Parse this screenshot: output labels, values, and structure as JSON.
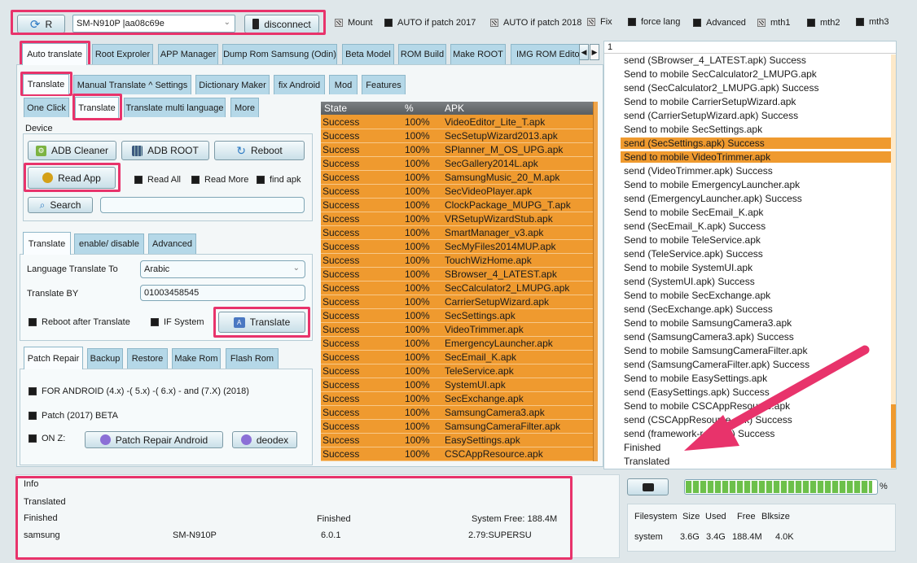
{
  "toolbar": {
    "refresh_label": "R",
    "device_select_value": "SM-N910P |aa08c69e",
    "disconnect_label": "disconnect",
    "options": [
      {
        "label": "Mount",
        "state": "indeterminate"
      },
      {
        "label": "AUTO if patch 2017",
        "state": "checked"
      },
      {
        "label": "AUTO if patch 2018",
        "state": "indeterminate"
      },
      {
        "label": "Fix",
        "state": "indeterminate"
      },
      {
        "label": "force lang",
        "state": "checked"
      },
      {
        "label": "Advanced",
        "state": "checked"
      },
      {
        "label": "mth1",
        "state": "indeterminate"
      },
      {
        "label": "mth2",
        "state": "checked"
      },
      {
        "label": "mth3",
        "state": "checked"
      }
    ]
  },
  "main_tabs": [
    "Auto translate",
    "Root Exproler",
    "APP Manager",
    "Dump Rom Samsung (Odin)",
    "Beta Model",
    "ROM Build",
    "Make ROOT",
    "IMG ROM Editor"
  ],
  "sub_tabs": [
    "Translate",
    "Manual Translate ^ Settings",
    "Dictionary Maker",
    "fix Android",
    "Mod",
    "Features"
  ],
  "sub_tabs2": [
    "One Click",
    "Translate",
    "Translate multi language",
    "More"
  ],
  "device": {
    "group_label": "Device",
    "adb_cleaner": "ADB Cleaner",
    "adb_root": "ADB ROOT",
    "reboot": "Reboot",
    "read_app": "Read App",
    "read_all": "Read All",
    "read_more": "Read More",
    "find_apk": "find apk",
    "search": "Search",
    "search_value": ""
  },
  "translate_tabs": [
    "Translate",
    "enable/ disable",
    "Advanced"
  ],
  "translate": {
    "lang_label": "Language Translate To",
    "lang_value": "Arabic",
    "by_label": "Translate BY",
    "by_value": "01003458545",
    "reboot_after": "Reboot after Translate",
    "if_system": "IF System",
    "translate_button": "Translate"
  },
  "patch_tabs": [
    "Patch Repair",
    "Backup",
    "Restore",
    "Make Rom",
    "Flash Rom"
  ],
  "patch": {
    "for_android": "FOR  ANDROID (4.x)  -( 5.x) -( 6.x) - and  (7.X)  (2018)",
    "patch_2017": "Patch   (2017) BETA",
    "on_z": "ON Z:",
    "patch_repair_button": "Patch Repair Android",
    "deodex_button": "deodex"
  },
  "apk_table": {
    "headers": [
      "State",
      "%",
      "APK"
    ],
    "rows": [
      [
        "Success",
        "100%",
        "VideoEditor_Lite_T.apk"
      ],
      [
        "Success",
        "100%",
        "SecSetupWizard2013.apk"
      ],
      [
        "Success",
        "100%",
        "SPlanner_M_OS_UPG.apk"
      ],
      [
        "Success",
        "100%",
        "SecGallery2014L.apk"
      ],
      [
        "Success",
        "100%",
        "SamsungMusic_20_M.apk"
      ],
      [
        "Success",
        "100%",
        "SecVideoPlayer.apk"
      ],
      [
        "Success",
        "100%",
        "ClockPackage_MUPG_T.apk"
      ],
      [
        "Success",
        "100%",
        "VRSetupWizardStub.apk"
      ],
      [
        "Success",
        "100%",
        "SmartManager_v3.apk"
      ],
      [
        "Success",
        "100%",
        "SecMyFiles2014MUP.apk"
      ],
      [
        "Success",
        "100%",
        "TouchWizHome.apk"
      ],
      [
        "Success",
        "100%",
        "SBrowser_4_LATEST.apk"
      ],
      [
        "Success",
        "100%",
        "SecCalculator2_LMUPG.apk"
      ],
      [
        "Success",
        "100%",
        "CarrierSetupWizard.apk"
      ],
      [
        "Success",
        "100%",
        "SecSettings.apk"
      ],
      [
        "Success",
        "100%",
        "VideoTrimmer.apk"
      ],
      [
        "Success",
        "100%",
        "EmergencyLauncher.apk"
      ],
      [
        "Success",
        "100%",
        "SecEmail_K.apk"
      ],
      [
        "Success",
        "100%",
        "TeleService.apk"
      ],
      [
        "Success",
        "100%",
        "SystemUI.apk"
      ],
      [
        "Success",
        "100%",
        "SecExchange.apk"
      ],
      [
        "Success",
        "100%",
        "SamsungCamera3.apk"
      ],
      [
        "Success",
        "100%",
        "SamsungCameraFilter.apk"
      ],
      [
        "Success",
        "100%",
        "EasySettings.apk"
      ],
      [
        "Success",
        "100%",
        "CSCAppResource.apk"
      ]
    ]
  },
  "log": {
    "header": "1",
    "lines": [
      {
        "text": "send  (SBrowser_4_LATEST.apk) Success",
        "highlight": false
      },
      {
        "text": "Send to mobile SecCalculator2_LMUPG.apk",
        "highlight": false
      },
      {
        "text": "send  (SecCalculator2_LMUPG.apk) Success",
        "highlight": false
      },
      {
        "text": "Send to mobile CarrierSetupWizard.apk",
        "highlight": false
      },
      {
        "text": "send  (CarrierSetupWizard.apk) Success",
        "highlight": false
      },
      {
        "text": "Send to mobile SecSettings.apk",
        "highlight": false
      },
      {
        "text": "send  (SecSettings.apk) Success",
        "highlight": true
      },
      {
        "text": "Send to mobile VideoTrimmer.apk",
        "highlight": true
      },
      {
        "text": "send  (VideoTrimmer.apk) Success",
        "highlight": false
      },
      {
        "text": "Send to mobile EmergencyLauncher.apk",
        "highlight": false
      },
      {
        "text": "send  (EmergencyLauncher.apk) Success",
        "highlight": false
      },
      {
        "text": "Send to mobile SecEmail_K.apk",
        "highlight": false
      },
      {
        "text": "send  (SecEmail_K.apk) Success",
        "highlight": false
      },
      {
        "text": "Send to mobile TeleService.apk",
        "highlight": false
      },
      {
        "text": "send  (TeleService.apk) Success",
        "highlight": false
      },
      {
        "text": "Send to mobile SystemUI.apk",
        "highlight": false
      },
      {
        "text": "send  (SystemUI.apk) Success",
        "highlight": false
      },
      {
        "text": "Send to mobile SecExchange.apk",
        "highlight": false
      },
      {
        "text": "send  (SecExchange.apk) Success",
        "highlight": false
      },
      {
        "text": "Send to mobile SamsungCamera3.apk",
        "highlight": false
      },
      {
        "text": "send  (SamsungCamera3.apk) Success",
        "highlight": false
      },
      {
        "text": "Send to mobile SamsungCameraFilter.apk",
        "highlight": false
      },
      {
        "text": "send  (SamsungCameraFilter.apk) Success",
        "highlight": false
      },
      {
        "text": "Send to mobile EasySettings.apk",
        "highlight": false
      },
      {
        "text": "send  (EasySettings.apk) Success",
        "highlight": false
      },
      {
        "text": "Send to mobile CSCAppResource.apk",
        "highlight": false
      },
      {
        "text": "send  (CSCAppResource.apk) Success",
        "highlight": false
      },
      {
        "text": "send  (framework-res.apk) Success",
        "highlight": false
      },
      {
        "text": "Finished",
        "highlight": false
      },
      {
        "text": "Translated",
        "highlight": false
      }
    ]
  },
  "info": {
    "label": "Info",
    "status1": "Translated",
    "status2": "Finished",
    "finished": "Finished",
    "system_free": "System Free: 188.4M",
    "brand": "samsung",
    "model": "SM-N910P",
    "android": "6.0.1",
    "su": "2.79:SUPERSU"
  },
  "progress": {
    "percent_label": "%",
    "fraction": 0.98
  },
  "filesystem": {
    "headers": [
      "Filesystem",
      "Size",
      "Used",
      "Free",
      "Blksize"
    ],
    "row": [
      "system",
      "3.6G",
      "3.4G",
      "188.4M",
      "4.0K"
    ]
  },
  "colors": {
    "accent_highlight": "#e8336b",
    "row_orange": "#ef9a2f",
    "progress_green": "#6cc04a"
  }
}
